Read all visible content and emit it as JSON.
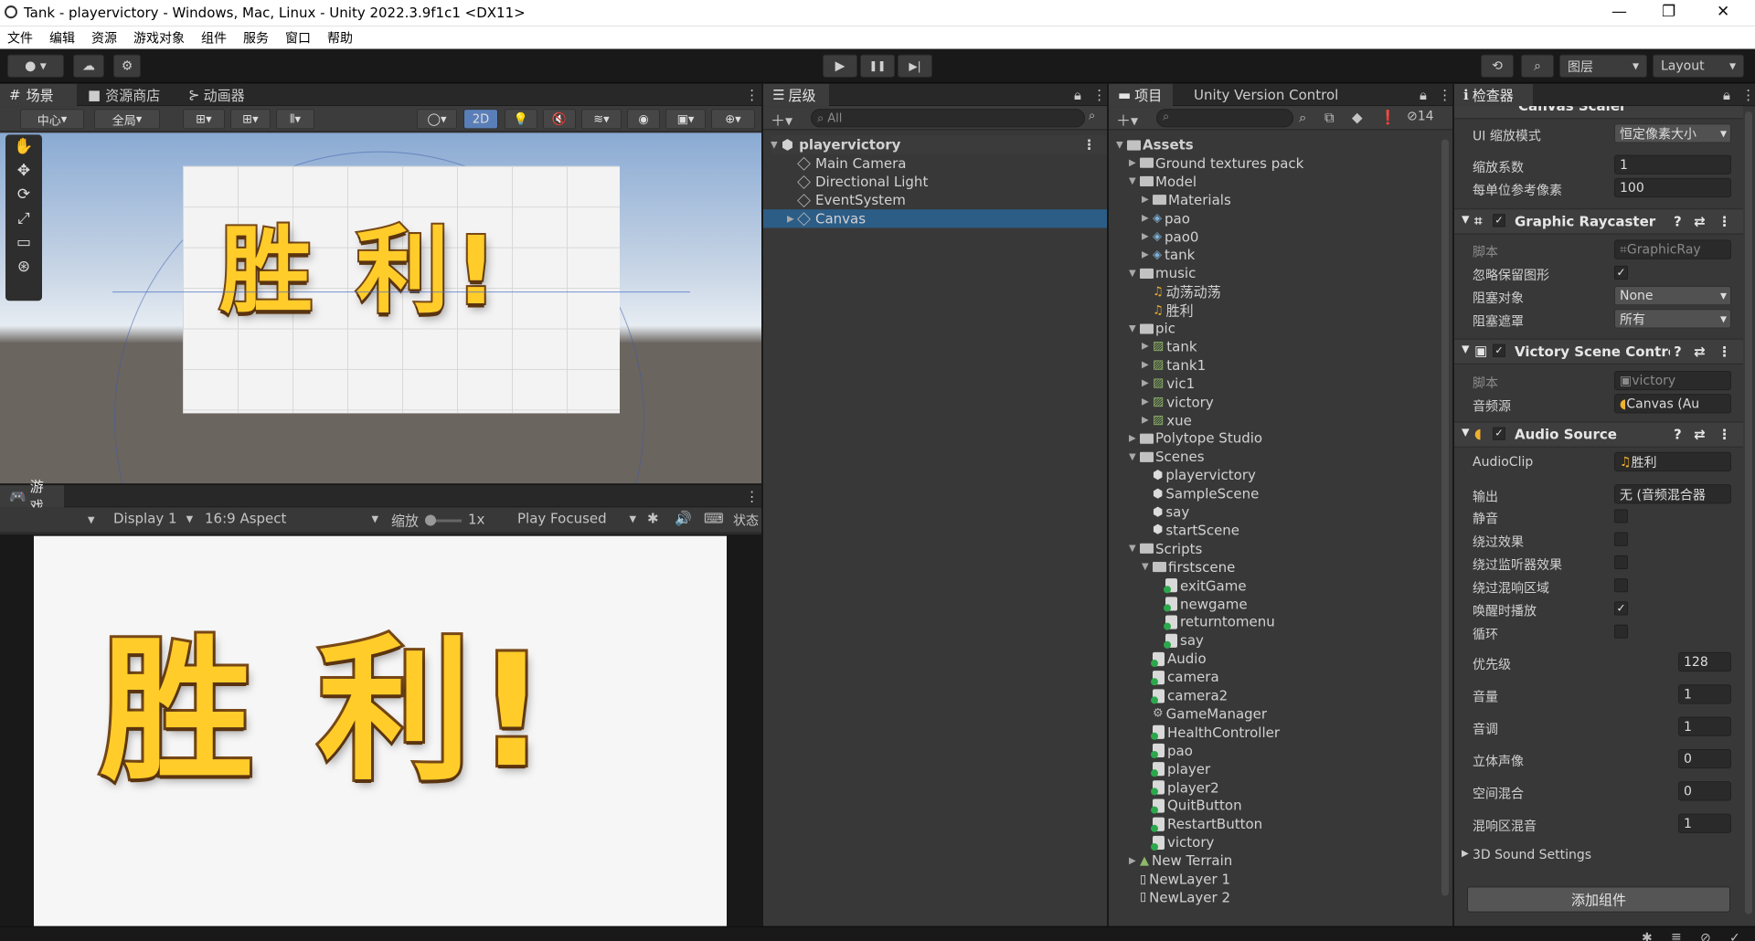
{
  "window": {
    "title": "Tank - playervictory - Windows, Mac, Linux - Unity 2022.3.9f1c1 <DX11>",
    "min": "—",
    "max": "❐",
    "close": "✕"
  },
  "menu": [
    "文件",
    "编辑",
    "资源",
    "游戏对象",
    "组件",
    "服务",
    "窗口",
    "帮助"
  ],
  "toolbar": {
    "play": "▶",
    "pause": "❚❚",
    "step": "▶|",
    "layers": "图层",
    "layout": "Layout"
  },
  "scene": {
    "tabs": [
      "场景",
      "资源商店",
      "动画器"
    ],
    "pivot": "中心",
    "global": "全局",
    "mode2d": "2D"
  },
  "game": {
    "tab": "游戏",
    "display": "Display 1",
    "aspect": "16:9 Aspect",
    "scale_label": "缩放",
    "scale_value": "1x",
    "play_mode": "Play Focused",
    "stats": "状态"
  },
  "victory_text": "胜 利!",
  "hierarchy": {
    "tab": "层级",
    "search_placeholder": "All",
    "scene": "playervictory",
    "items": [
      "Main Camera",
      "Directional Light",
      "EventSystem",
      "Canvas"
    ]
  },
  "project": {
    "tab": "项目",
    "tab2": "Unity Version Control",
    "hidden_count": "14",
    "items": [
      {
        "t": "Assets",
        "d": 0,
        "k": "fold",
        "a": "▼",
        "b": true
      },
      {
        "t": "Ground textures pack",
        "d": 1,
        "k": "fold",
        "a": "▶"
      },
      {
        "t": "Model",
        "d": 1,
        "k": "fold",
        "a": "▼"
      },
      {
        "t": "Materials",
        "d": 2,
        "k": "fold",
        "a": "▶"
      },
      {
        "t": "pao",
        "d": 2,
        "k": "prefab",
        "a": "▶"
      },
      {
        "t": "pao0",
        "d": 2,
        "k": "prefab",
        "a": "▶"
      },
      {
        "t": "tank",
        "d": 2,
        "k": "prefab",
        "a": "▶"
      },
      {
        "t": "music",
        "d": 1,
        "k": "fold",
        "a": "▼"
      },
      {
        "t": "动荡动荡",
        "d": 2,
        "k": "audio",
        "a": ""
      },
      {
        "t": "胜利",
        "d": 2,
        "k": "audio",
        "a": ""
      },
      {
        "t": "pic",
        "d": 1,
        "k": "fold",
        "a": "▼"
      },
      {
        "t": "tank",
        "d": 2,
        "k": "img",
        "a": "▶"
      },
      {
        "t": "tank1",
        "d": 2,
        "k": "img",
        "a": "▶"
      },
      {
        "t": "vic1",
        "d": 2,
        "k": "img",
        "a": "▶"
      },
      {
        "t": "victory",
        "d": 2,
        "k": "img",
        "a": "▶"
      },
      {
        "t": "xue",
        "d": 2,
        "k": "img",
        "a": "▶"
      },
      {
        "t": "Polytope Studio",
        "d": 1,
        "k": "fold",
        "a": "▶"
      },
      {
        "t": "Scenes",
        "d": 1,
        "k": "fold",
        "a": "▼"
      },
      {
        "t": "playervictory",
        "d": 2,
        "k": "unity",
        "a": ""
      },
      {
        "t": "SampleScene",
        "d": 2,
        "k": "unity",
        "a": ""
      },
      {
        "t": "say",
        "d": 2,
        "k": "unity",
        "a": ""
      },
      {
        "t": "startScene",
        "d": 2,
        "k": "unity",
        "a": ""
      },
      {
        "t": "Scripts",
        "d": 1,
        "k": "fold",
        "a": "▼"
      },
      {
        "t": "firstscene",
        "d": 2,
        "k": "fold",
        "a": "▼"
      },
      {
        "t": "exitGame",
        "d": 3,
        "k": "cs",
        "a": ""
      },
      {
        "t": "newgame",
        "d": 3,
        "k": "cs",
        "a": ""
      },
      {
        "t": "returntomenu",
        "d": 3,
        "k": "cs",
        "a": ""
      },
      {
        "t": "say",
        "d": 3,
        "k": "cs",
        "a": ""
      },
      {
        "t": "Audio",
        "d": 2,
        "k": "cs",
        "a": ""
      },
      {
        "t": "camera",
        "d": 2,
        "k": "cs",
        "a": ""
      },
      {
        "t": "camera2",
        "d": 2,
        "k": "cs",
        "a": ""
      },
      {
        "t": "GameManager",
        "d": 2,
        "k": "gear",
        "a": ""
      },
      {
        "t": "HealthController",
        "d": 2,
        "k": "cs",
        "a": ""
      },
      {
        "t": "pao",
        "d": 2,
        "k": "cs",
        "a": ""
      },
      {
        "t": "player",
        "d": 2,
        "k": "cs",
        "a": ""
      },
      {
        "t": "player2",
        "d": 2,
        "k": "cs",
        "a": ""
      },
      {
        "t": "QuitButton",
        "d": 2,
        "k": "cs",
        "a": ""
      },
      {
        "t": "RestartButton",
        "d": 2,
        "k": "cs",
        "a": ""
      },
      {
        "t": "victory",
        "d": 2,
        "k": "cs",
        "a": ""
      },
      {
        "t": "New Terrain",
        "d": 1,
        "k": "terrain",
        "a": "▶"
      },
      {
        "t": "NewLayer 1",
        "d": 1,
        "k": "file",
        "a": ""
      },
      {
        "t": "NewLayer 2",
        "d": 1,
        "k": "file",
        "a": ""
      }
    ]
  },
  "inspector": {
    "tab": "检查器",
    "canvas_scaler": {
      "title": "Canvas Scaler",
      "ui_scale_mode_label": "UI 缩放模式",
      "ui_scale_mode": "恒定像素大小",
      "scale_factor_label": "缩放系数",
      "scale_factor": "1",
      "ppu_label": "每单位参考像素",
      "ppu": "100"
    },
    "graphic_raycaster": {
      "title": "Graphic Raycaster",
      "script_label": "脚本",
      "script": "GraphicRay",
      "ignore_label": "忽略保留图形",
      "blocking_objects_label": "阻塞对象",
      "blocking_objects": "None",
      "blocking_mask_label": "阻塞遮罩",
      "blocking_mask": "所有"
    },
    "victory_controller": {
      "title": "Victory Scene Contro",
      "script_label": "脚本",
      "script": "victory",
      "audio_label": "音频源",
      "audio": "Canvas (Au"
    },
    "audio_source": {
      "title": "Audio Source",
      "clip_label": "AudioClip",
      "clip": "胜利",
      "output_label": "输出",
      "output": "无 (音频混合器",
      "mute_label": "静音",
      "bypass_effects_label": "绕过效果",
      "bypass_listener_label": "绕过监听器效果",
      "bypass_reverb_label": "绕过混响区域",
      "play_on_awake_label": "唤醒时播放",
      "loop_label": "循环",
      "priority_label": "优先级",
      "priority": "128",
      "volume_label": "音量",
      "volume": "1",
      "pitch_label": "音调",
      "pitch": "1",
      "stereo_label": "立体声像",
      "stereo": "0",
      "spatial_label": "空间混合",
      "spatial": "0",
      "reverb_label": "混响区混音",
      "reverb": "1",
      "sound_settings": "3D Sound Settings"
    },
    "add_component": "添加组件"
  }
}
